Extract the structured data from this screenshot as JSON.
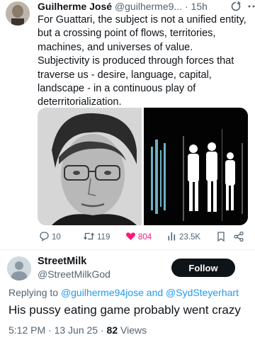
{
  "tweet": {
    "author_name": "Guilherme José",
    "author_handle": "@guilherme9...",
    "separator": "·",
    "time": "15h",
    "lines": [
      "For Guattari, the subject is not a unified entity,",
      "but a crossing point of flows, territories,",
      "machines, and universes of value.",
      "Subjectivity is produced through forces that",
      "traverse us - desire, language, capital,",
      "landscape - in a continuous play of",
      "deterritorialization."
    ],
    "replies": "10",
    "reposts": "119",
    "likes": "804",
    "views": "23.5K"
  },
  "reply": {
    "author_name": "StreetMilk",
    "author_handle": "@StreetMilkGod",
    "follow_label": "Follow",
    "replying_to_label": "Replying to",
    "mention_1": "@guilherme94jose",
    "conj": "and",
    "mention_2": "@SydSteyerhart",
    "text": "His pussy eating game probably went crazy",
    "time": "5:12 PM · 13 Jun 25 ·",
    "views_count": "82",
    "views_label": "Views"
  },
  "colors": {
    "text": "#0f1419",
    "muted": "#536471",
    "link": "#1d9bf0",
    "like": "#f91880"
  },
  "icons": [
    "avatar",
    "repost-icon",
    "more-icon",
    "reply-icon",
    "retweet-icon",
    "heart-icon",
    "views-icon",
    "bookmark-icon",
    "share-icon"
  ]
}
